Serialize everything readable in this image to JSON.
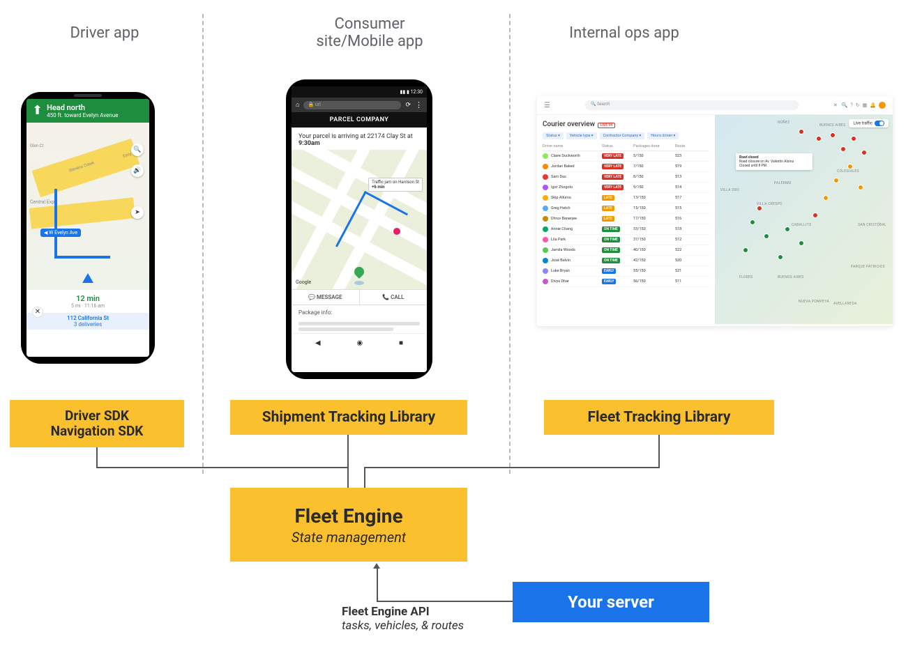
{
  "headings": {
    "driver": "Driver app",
    "consumer": "Consumer\nsite/Mobile app",
    "ops": "Internal ops app"
  },
  "driver": {
    "direction": "Head north",
    "distance": "450 ft.",
    "toward": "toward Evelyn Avenue",
    "street_label": "W Evelyn Ave",
    "map_labels": {
      "central": "Central Expy",
      "glen": "Glen Ct",
      "creek": "Stevens Creek",
      "easy": "Easy St"
    },
    "eta_min": "12 min",
    "eta_detail": "5 mi · 11:16 am",
    "dest": "112 California St",
    "deliveries": "3 deliveries"
  },
  "consumer": {
    "status_time": "12:30",
    "url": "url",
    "company": "PARCEL COMPANY",
    "msg_prefix": "Your parcel is arriving at 22174 Clay St at",
    "msg_time": "9:30am",
    "traffic": "Traffic jam on Harrison St",
    "traffic_delay": "+6 min",
    "google": "Google",
    "btn_msg": "MESSAGE",
    "btn_call": "CALL",
    "pkg_info": "Package info:"
  },
  "ops": {
    "search_placeholder": "Search",
    "title": "Courier overview",
    "live": "LIVE 94",
    "filters": [
      "Status ▾",
      "Vehicle type ▾",
      "Contractor Company ▾",
      "Hours driven ▾"
    ],
    "cols": [
      "Driver name",
      "Status",
      "Packages done",
      "Route"
    ],
    "rows": [
      {
        "name": "Claire Duckworth",
        "status": "VERY LATE",
        "cls": "verylate",
        "pkg": "5/150",
        "route": "523",
        "c": "#8e5"
      },
      {
        "name": "Jordan Baked",
        "status": "VERY LATE",
        "cls": "verylate",
        "pkg": "7/150",
        "route": "519",
        "c": "#f80"
      },
      {
        "name": "Sam Das",
        "status": "VERY LATE",
        "cls": "verylate",
        "pkg": "8/150",
        "route": "513",
        "c": "#e33"
      },
      {
        "name": "Igor Zhogolo",
        "status": "VERY LATE",
        "cls": "verylate",
        "pkg": "9/150",
        "route": "514",
        "c": "#a5f"
      },
      {
        "name": "Skip Allums",
        "status": "LATE",
        "cls": "late",
        "pkg": "13/150",
        "route": "517",
        "c": "#fa0"
      },
      {
        "name": "Greg Hatch",
        "status": "LATE",
        "cls": "late",
        "pkg": "15/150",
        "route": "515",
        "c": "#5af"
      },
      {
        "name": "Dhruv Banerjee",
        "status": "LATE",
        "cls": "late",
        "pkg": "17/150",
        "route": "516",
        "c": "#c80"
      },
      {
        "name": "Annie Chang",
        "status": "ON TIME",
        "cls": "ontime",
        "pkg": "33/150",
        "route": "518",
        "c": "#0a6"
      },
      {
        "name": "Lila Park",
        "status": "ON TIME",
        "cls": "ontime",
        "pkg": "37/150",
        "route": "512",
        "c": "#f5a"
      },
      {
        "name": "Jamila Woods",
        "status": "ON TIME",
        "cls": "ontime",
        "pkg": "40/150",
        "route": "522",
        "c": "#5c5"
      },
      {
        "name": "José Balvin",
        "status": "ON TIME",
        "cls": "ontime",
        "pkg": "42/150",
        "route": "520",
        "c": "#08c"
      },
      {
        "name": "Luke Bryan",
        "status": "EARLY",
        "cls": "early",
        "pkg": "55/150",
        "route": "521",
        "c": "#88f"
      },
      {
        "name": "Divya Dhar",
        "status": "EARLY",
        "cls": "early",
        "pkg": "56/150",
        "route": "511",
        "c": "#c5c"
      }
    ],
    "live_traffic": "Live traffic",
    "popup_title": "Road closed",
    "popup_body": "Road closure on Av. Valentín Alsina\nClosed until 8 PM",
    "regions": [
      "NÚÑEZ",
      "BUENOS AIRES",
      "COLEGIALES",
      "VILLA ORO",
      "CABALLITO",
      "FLORES",
      "BUENOS AIRES",
      "SAN CRISTÓBAL",
      "PARQUE PATRICIOS",
      "NUEVA POMPEYA",
      "AVELLANEDA",
      "PALERMO",
      "VILLA CRESPO"
    ]
  },
  "boxes": {
    "driver_sdk_l1": "Driver SDK",
    "driver_sdk_l2": "Navigation SDK",
    "shipment": "Shipment Tracking Library",
    "fleet_track": "Fleet Tracking Library",
    "engine": "Fleet Engine",
    "engine_sub": "State management",
    "server": "Your server"
  },
  "api": {
    "title": "Fleet Engine API",
    "sub": "tasks, vehicles, & routes"
  }
}
